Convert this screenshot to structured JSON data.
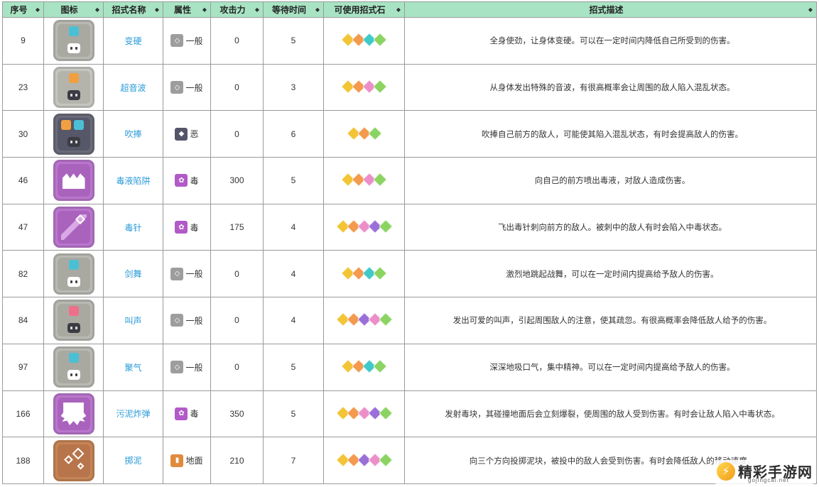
{
  "table": {
    "headers": [
      "序号",
      "图标",
      "招式名称",
      "属性",
      "攻击力",
      "等待时间",
      "可使用招式石",
      "招式描述"
    ],
    "rows": [
      {
        "id": "9",
        "name": "变硬",
        "attr": "一般",
        "attr_type": "normal",
        "power": "0",
        "wait": "5",
        "stones": [
          "#f2c436",
          "#f39a4e",
          "#3fc9c9",
          "#8bd462"
        ],
        "desc": "全身使劲，让身体变硬。可以在一定时间内降低自己所受到的伤害。",
        "icon": "shield-bubble-icon",
        "icon_bg": "#b9b9b3",
        "icon_inner": "#a9a9a2",
        "bubble_colors": [
          "#4bc0d4"
        ],
        "robot": "light"
      },
      {
        "id": "23",
        "name": "超音波",
        "attr": "一般",
        "attr_type": "normal",
        "power": "0",
        "wait": "3",
        "stones": [
          "#f2c436",
          "#f39a4e",
          "#ec8fc8",
          "#8bd462"
        ],
        "desc": "从身体发出特殊的音波，有很高概率会让周围的敌人陷入混乱状态。",
        "icon": "sound-wave-icon",
        "icon_bg": "#c5c5c0",
        "icon_inner": "#b4b4ad",
        "bubble_colors": [
          "#f0a040"
        ],
        "robot": "dark"
      },
      {
        "id": "30",
        "name": "吹捧",
        "attr": "恶",
        "attr_type": "dark",
        "power": "0",
        "wait": "6",
        "stones": [
          "#f2c436",
          "#f39a4e",
          "#8bd462"
        ],
        "desc": "吹捧自己前方的敌人，可能使其陷入混乱状态，有时会提高敌人的伤害。",
        "icon": "flatter-bubbles-icon",
        "icon_bg": "#6a6a78",
        "icon_inner": "#57576a",
        "bubble_colors": [
          "#f0a040",
          "#4bc0d4"
        ],
        "robot": "dark"
      },
      {
        "id": "46",
        "name": "毒液陷阱",
        "attr": "毒",
        "attr_type": "poison",
        "power": "300",
        "wait": "5",
        "stones": [
          "#f2c436",
          "#f39a4e",
          "#ec8fc8",
          "#8bd462"
        ],
        "desc": "向自己的前方喷出毒液，对敌人造成伤害。",
        "icon": "venom-trap-icon",
        "icon_bg": "#b976cc",
        "icon_inner": "#a963bd",
        "bubble_colors": [],
        "robot": "none"
      },
      {
        "id": "47",
        "name": "毒针",
        "attr": "毒",
        "attr_type": "poison",
        "power": "175",
        "wait": "4",
        "stones": [
          "#f2c436",
          "#f39a4e",
          "#ec8fc8",
          "#9a6fd8",
          "#8bd462"
        ],
        "desc": "飞出毒针刺向前方的敌人。被刺中的敌人有时会陷入中毒状态。",
        "icon": "poison-needle-icon",
        "icon_bg": "#b976cc",
        "icon_inner": "#a963bd",
        "bubble_colors": [],
        "robot": "none"
      },
      {
        "id": "82",
        "name": "剑舞",
        "attr": "一般",
        "attr_type": "normal",
        "power": "0",
        "wait": "4",
        "stones": [
          "#f2c436",
          "#f39a4e",
          "#3fc9c9",
          "#8bd462"
        ],
        "desc": "激烈地跳起战舞，可以在一定时间内提高给予敌人的伤害。",
        "icon": "sword-dance-icon",
        "icon_bg": "#b9b9b3",
        "icon_inner": "#a9a9a2",
        "bubble_colors": [
          "#4bc0d4"
        ],
        "robot": "light"
      },
      {
        "id": "84",
        "name": "叫声",
        "attr": "一般",
        "attr_type": "normal",
        "power": "0",
        "wait": "4",
        "stones": [
          "#f2c436",
          "#f39a4e",
          "#9a6fd8",
          "#ec8fc8",
          "#8bd462"
        ],
        "desc": "发出可爱的叫声，引起周围敌人的注意，使其疏忽。有很高概率会降低敌人给予的伤害。",
        "icon": "growl-icon",
        "icon_bg": "#b9b9b3",
        "icon_inner": "#a9a9a2",
        "bubble_colors": [
          "#ef6f8a"
        ],
        "robot": "dark"
      },
      {
        "id": "97",
        "name": "聚气",
        "attr": "一般",
        "attr_type": "normal",
        "power": "0",
        "wait": "5",
        "stones": [
          "#f2c436",
          "#f39a4e",
          "#3fc9c9",
          "#8bd462"
        ],
        "desc": "深深地吸口气，集中精神。可以在一定时间内提高给予敌人的伤害。",
        "icon": "focus-energy-icon",
        "icon_bg": "#b9b9b3",
        "icon_inner": "#a9a9a2",
        "bubble_colors": [
          "#4bc0d4"
        ],
        "robot": "light"
      },
      {
        "id": "166",
        "name": "污泥炸弹",
        "attr": "毒",
        "attr_type": "poison",
        "power": "350",
        "wait": "5",
        "stones": [
          "#f2c436",
          "#f39a4e",
          "#ec8fc8",
          "#9a6fd8",
          "#8bd462"
        ],
        "desc": "发射毒块，其碰撞地面后会立刻爆裂，使周围的敌人受到伤害。有时会让敌人陷入中毒状态。",
        "icon": "sludge-bomb-icon",
        "icon_bg": "#b976cc",
        "icon_inner": "#a963bd",
        "bubble_colors": [],
        "robot": "none"
      },
      {
        "id": "188",
        "name": "掷泥",
        "attr": "地面",
        "attr_type": "ground",
        "power": "210",
        "wait": "7",
        "stones": [
          "#f2c436",
          "#f39a4e",
          "#9a6fd8",
          "#ec8fc8",
          "#8bd462"
        ],
        "desc": "向三个方向投掷泥块，被投中的敌人会受到伤害。有时会降低敌人的移动速度。",
        "icon": "mud-shot-icon",
        "icon_bg": "#c58456",
        "icon_inner": "#b8744a",
        "bubble_colors": [],
        "robot": "none"
      }
    ]
  },
  "attr_styles": {
    "normal": {
      "color": "#9d9d9d",
      "glyph": "◇"
    },
    "dark": {
      "color": "#55556a",
      "glyph": "◆"
    },
    "poison": {
      "color": "#b25ac8",
      "glyph": "✿"
    },
    "ground": {
      "color": "#e08a3c",
      "glyph": "▮"
    }
  },
  "watermark": {
    "title": "精彩手游网",
    "url": "gojingcai.net",
    "logo_glyph": "⚡"
  },
  "sort_glyph": "◆"
}
